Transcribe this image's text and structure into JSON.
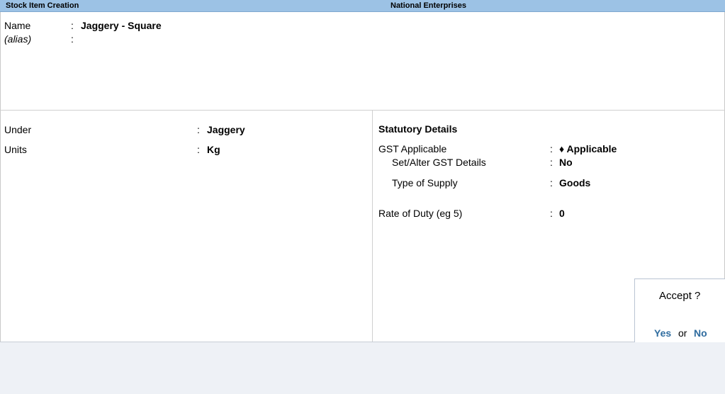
{
  "title_bar": {
    "screen_title": "Stock Item Creation",
    "company": "National Enterprises"
  },
  "header_fields": {
    "name_label": "Name",
    "name_value": "Jaggery - Square",
    "alias_label": "(alias)",
    "alias_value": "",
    "colon": ":"
  },
  "left_fields": [
    {
      "label": "Under",
      "value": "Jaggery"
    },
    {
      "label": "Units",
      "value": "Kg"
    }
  ],
  "statutory": {
    "heading": "Statutory Details",
    "gst_applicable_label": "GST Applicable",
    "gst_applicable_value": "♦ Applicable",
    "set_alter_label": "Set/Alter GST Details",
    "set_alter_value": "No",
    "supply_label": "Type of Supply",
    "supply_value": "Goods",
    "rate_label": "Rate of Duty (eg 5)",
    "rate_value": "0"
  },
  "accept_dialog": {
    "title": "Accept ?",
    "yes": "Yes",
    "or": "or",
    "no": "No"
  },
  "colors": {
    "title_bar_bg": "#9cc2e5",
    "link_blue": "#2f6c9f"
  }
}
